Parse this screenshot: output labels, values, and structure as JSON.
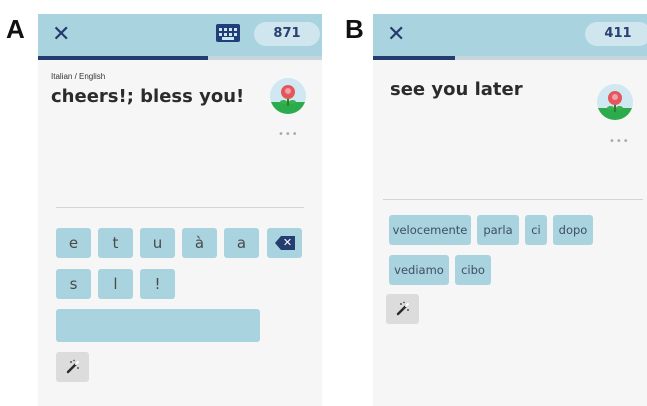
{
  "panel_a": {
    "letter": "A",
    "score": "871",
    "progress_fraction": 0.6,
    "language_label": "Italian / English",
    "prompt": "cheers!; bless you!",
    "more_label": "•••",
    "keys": [
      "e",
      "t",
      "u",
      "à",
      "a",
      "s",
      "l",
      "!"
    ],
    "answer_value": "",
    "icons": [
      "close-icon",
      "keyboard-icon",
      "avatar-flower-icon",
      "backspace-icon",
      "magic-wand-icon"
    ]
  },
  "panel_b": {
    "letter": "B",
    "score": "411",
    "progress_fraction": 0.3,
    "prompt": "see you later",
    "more_label": "•••",
    "words": [
      "velocemente",
      "parla",
      "ci",
      "dopo",
      "vediamo",
      "cibo"
    ],
    "icons": [
      "close-icon",
      "avatar-flower-icon",
      "magic-wand-icon"
    ]
  },
  "colors": {
    "accent": "#a9d3df",
    "navy": "#233d6f",
    "background": "#f6f6f6"
  }
}
